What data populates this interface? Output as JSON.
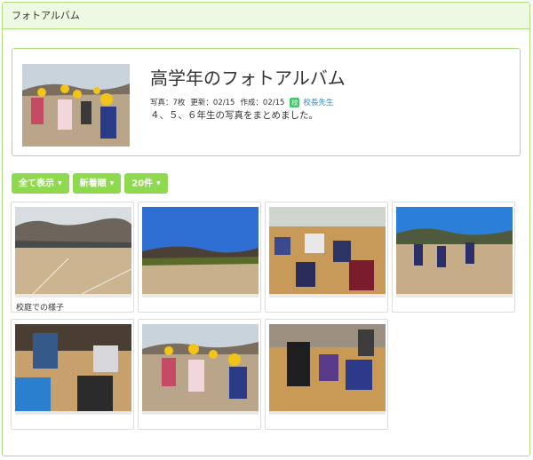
{
  "panel": {
    "title": "フォトアルバム"
  },
  "album": {
    "title": "高学年のフォトアルバム",
    "photo_count": "写真：7枚",
    "updated": "更新：02/15",
    "created": "作成：02/15",
    "role_badge": "校",
    "author": "校長先生",
    "description": "４、５、６年生の写真をまとめました。"
  },
  "toolbar": {
    "show_all": "全て表示",
    "sort": "新着順",
    "per_page": "20件"
  },
  "photos": [
    {
      "caption": "校庭での様子"
    },
    {
      "caption": ""
    },
    {
      "caption": ""
    },
    {
      "caption": ""
    },
    {
      "caption": ""
    },
    {
      "caption": ""
    },
    {
      "caption": ""
    }
  ],
  "colors": {
    "accent": "#8fd94f",
    "border": "#a9dd7c",
    "header_bg": "#eef9e4",
    "author": "#2e8ac9",
    "badge": "#44c36a"
  }
}
